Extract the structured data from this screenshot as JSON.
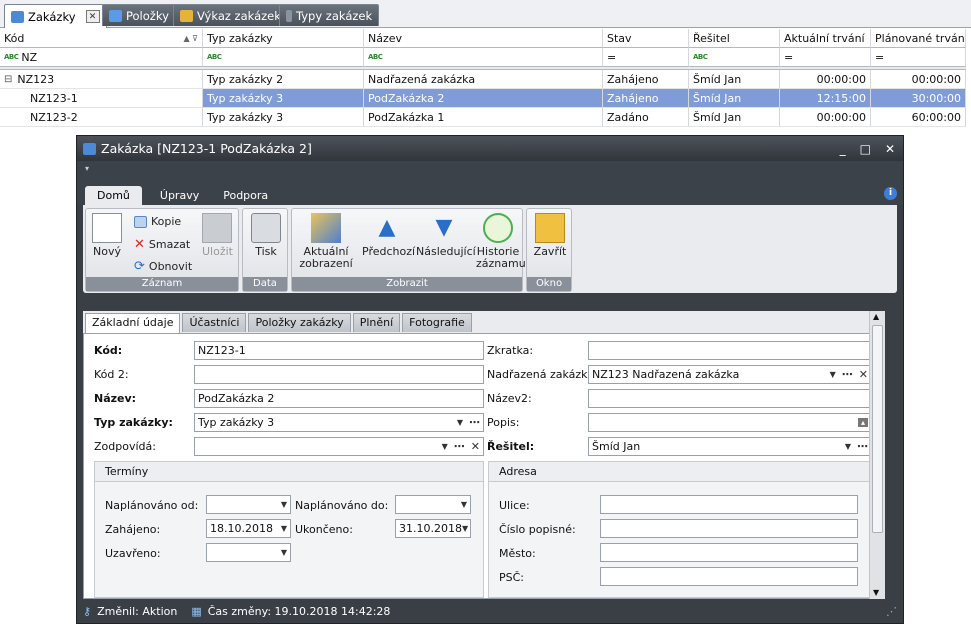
{
  "doc_tabs": [
    {
      "label": "Zakázky",
      "close": "✕"
    },
    {
      "label": "Položky"
    },
    {
      "label": "Výkaz zakázek"
    },
    {
      "label": "Typy zakázek"
    }
  ],
  "grid": {
    "headers": [
      "Kód",
      "Typ zakázky",
      "Název",
      "Stav",
      "Řešitel",
      "Aktuální trvání",
      "Plánované trvání"
    ],
    "filter_abc": "ABC",
    "filter_code": "NZ",
    "filter_eq": "=",
    "rows": [
      {
        "expand": "⊟",
        "code": "NZ123",
        "type": "Typ zakázky 2",
        "name": "Nadřazená zakázka",
        "state": "Zahájeno",
        "owner": "Šmíd Jan",
        "actual": "00:00:00",
        "planned": "00:00:00"
      },
      {
        "code": "NZ123-1",
        "type": "Typ zakázky 3",
        "name": "PodZakázka 2",
        "state": "Zahájeno",
        "owner": "Šmíd Jan",
        "actual": "12:15:00",
        "planned": "30:00:00"
      },
      {
        "code": "NZ123-2",
        "type": "Typ zakázky 3",
        "name": "PodZakázka 1",
        "state": "Zadáno",
        "owner": "Šmíd Jan",
        "actual": "00:00:00",
        "planned": "60:00:00"
      }
    ]
  },
  "window": {
    "title": "Zakázka [NZ123-1 PodZakázka 2]",
    "controls": [
      "_",
      "□",
      "✕"
    ],
    "ribbon_tabs": [
      "Domů",
      "Úpravy",
      "Podpora"
    ],
    "info": "i",
    "groups": {
      "zaznam": {
        "label": "Záznam",
        "new": "Nový",
        "copy": "Kopie",
        "delete": "Smazat",
        "refresh": "Obnovit",
        "save": "Uložit"
      },
      "data": {
        "label": "Data",
        "print": "Tisk"
      },
      "zobrazit": {
        "label": "Zobrazit",
        "current": "Aktuální zobrazení",
        "prev": "Předchozí",
        "next": "Následující",
        "history": "Historie záznamu"
      },
      "okno": {
        "label": "Okno",
        "close": "Zavřít"
      }
    },
    "form_tabs": [
      "Základní údaje",
      "Účastníci",
      "Položky zakázky",
      "Plnění",
      "Fotografie"
    ],
    "form": {
      "kod_label": "Kód:",
      "kod": "NZ123-1",
      "kod2_label": "Kód 2:",
      "kod2": "",
      "nazev_label": "Název:",
      "nazev": "PodZakázka 2",
      "typ_label": "Typ zakázky:",
      "typ": "Typ zakázky 3",
      "zodpovida_label": "Zodpovídá:",
      "zodpovida": "",
      "zkratka_label": "Zkratka:",
      "zkratka": "",
      "nadrazena_label": "Nadřazená zakázka:",
      "nadrazena": "NZ123 Nadřazená zakázka",
      "nazev2_label": "Název2:",
      "nazev2": "",
      "popis_label": "Popis:",
      "popis": "",
      "resitel_label": "Řešitel:",
      "resitel": "Šmíd Jan"
    },
    "terminy": {
      "title": "Termíny",
      "planned_from_label": "Naplánováno od:",
      "planned_from": "",
      "planned_to_label": "Naplánováno do:",
      "planned_to": "",
      "started_label": "Zahájeno:",
      "started": "18.10.2018",
      "ended_label": "Ukončeno:",
      "ended": "31.10.2018",
      "closed_label": "Uzavřeno:",
      "closed": ""
    },
    "adresa": {
      "title": "Adresa",
      "ulice_label": "Ulice:",
      "ulice": "",
      "cislo_label": "Číslo popisné:",
      "cislo": "",
      "mesto_label": "Město:",
      "mesto": "",
      "psc_label": "PSČ:",
      "psc": ""
    },
    "status": {
      "changed_by": "Změnil: Aktion",
      "changed_at": "Čas změny: 19.10.2018 14:42:28"
    }
  }
}
